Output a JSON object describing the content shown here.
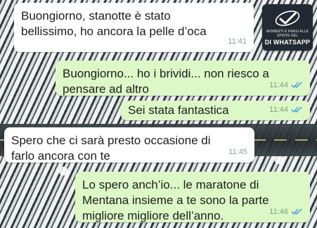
{
  "watermark": {
    "small_text": "MOMENTI E FRASI ALLE SPINTE DEL",
    "big_text": "DI WHATSAPP"
  },
  "messages": [
    {
      "direction": "in",
      "text": "Buongiorno, stanotte è stato\nbellissimo, ho ancora la pelle d’oca",
      "time": "11:41"
    },
    {
      "direction": "out",
      "text": "Buongiorno... ho i brividi... non riesco a\npensare ad altro",
      "time": "11:44",
      "status": "read"
    },
    {
      "direction": "out",
      "text": "Sei stata fantastica",
      "time": "11:44",
      "status": "read"
    },
    {
      "direction": "in",
      "text": "Spero che ci sarà presto occasione di\nfarlo ancora con te",
      "time": "11:45"
    },
    {
      "direction": "out",
      "text": "Lo spero anch’io... le maratone di\nMentana insieme a te sono la parte\nmigliore migliore dell’anno.",
      "time": "11:46",
      "status": "read"
    }
  ],
  "colors": {
    "incoming_bubble": "#ffffff",
    "outgoing_bubble": "#dcf8c6",
    "read_ticks": "#4fa3e0"
  },
  "icons": {
    "read_status": "double-check-icon",
    "watermark_logo": "checkmark-logo-icon"
  }
}
